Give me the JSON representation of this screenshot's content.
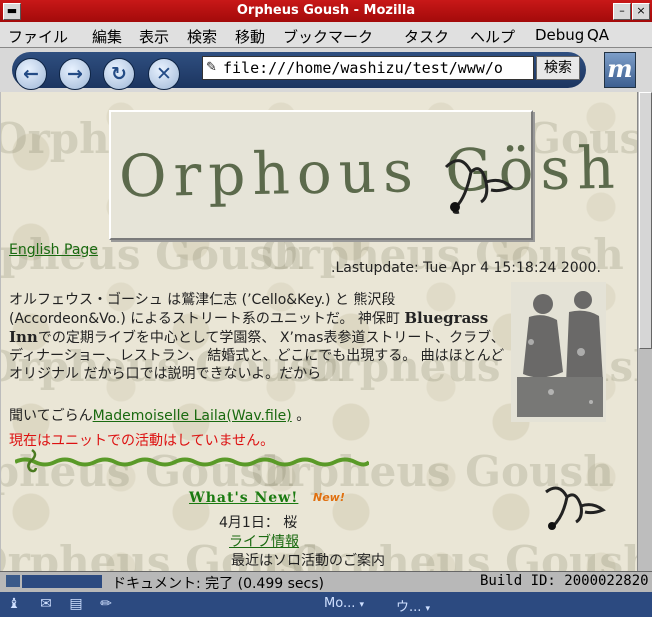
{
  "window": {
    "title": "Orpheus Goush - Mozilla",
    "minimize": "–",
    "close": "×"
  },
  "menu": [
    "ファイル",
    "編集",
    "表示",
    "検索",
    "移動",
    "ブックマーク",
    "タスク",
    "ヘルプ",
    "Debug",
    "QA"
  ],
  "nav": {
    "back": "←",
    "forward": "→",
    "reload": "↻",
    "stop": "✕",
    "url": "file:///home/washizu/test/www/o",
    "search_label": "検索",
    "logo": "m"
  },
  "page": {
    "banner_title": "Orphous Gösh",
    "bg_word": "Orpheus Goush",
    "english_link": "English Page",
    "lastupdate": ".Lastupdate: Tue Apr 4 15:18:24 2000.",
    "desc_1": "オルフェウス・ゴーシュ は鷲津仁志 (’Cello&Key.) と 熊沢段 (Accordeon&Vo.) によるストリート系のユニットだ。 神保町 ",
    "desc_bold": "Bluegrass Inn",
    "desc_2": "での定期ライブを中心として学園祭、 X’mas表参道ストリート、クラブ、ディナーショー、レストラン、 結婚式と、どこにでも出現する。 曲はほとんどオリジナル だから口では説明できないよ。だから",
    "listen_prefix": "聞いてごらん",
    "listen_link": "Mademoiselle Laila(Wav.file)",
    "listen_suffix": " 。",
    "status_msg": "現在はユニットでの活動はしていません。",
    "whats_new": "What's New!",
    "new_badge": "New!",
    "news_date": "4月1日：",
    "news_item": "桜",
    "live_link": "ライブ情報",
    "recent": "最近はソロ活動のご案内"
  },
  "status": {
    "doc": "ドキュメント: 完了 (0.499 secs)",
    "build": "Build ID: 2000022820"
  },
  "taskbar": {
    "item1": "Mo...",
    "item2": "ウ...",
    "arrow": "▾"
  }
}
